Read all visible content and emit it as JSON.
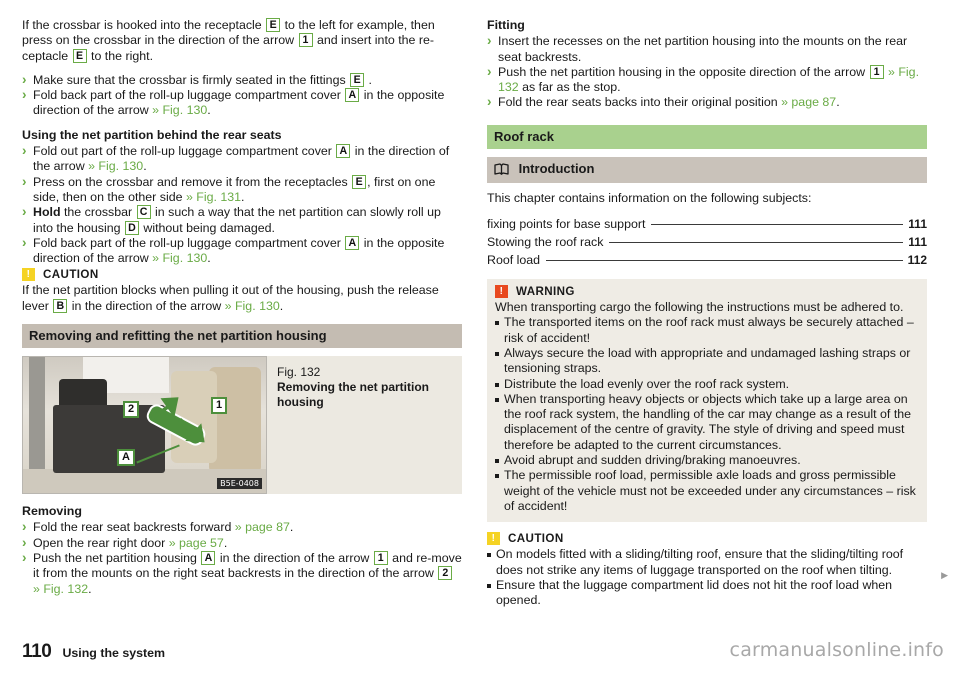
{
  "left_column": {
    "intro_paragraph_segments": [
      {
        "t": "If the crossbar is hooked into the receptacle "
      },
      {
        "t": "E",
        "ref": true
      },
      {
        "t": " to the left for example, then press on the crossbar in the direction of the arrow "
      },
      {
        "t": "1",
        "ref": true
      },
      {
        "t": " and insert into the receptacle "
      },
      {
        "t": "E",
        "ref": true
      },
      {
        "t": " to the right."
      }
    ],
    "intro_bullets": [
      "Make sure that the crossbar is firmly seated in the fittings E .",
      "Fold back part of the roll-up luggage compartment cover A in the opposite direction of the arrow » Fig. 130."
    ],
    "heading_using_net_partition": "Using the net partition behind the rear seats",
    "using_bullets": [
      "Fold out part of the roll-up luggage compartment cover A in the direction of the arrow » Fig. 130.",
      "Press on the crossbar and remove it from the receptacles E , first on one side, then on the other side » Fig. 131.",
      "Hold the crossbar C in such a way that the net partition can slowly roll up into the housing D without being damaged.",
      "Fold back part of the roll-up luggage compartment cover A in the opposite direction of the arrow » Fig. 130."
    ],
    "caution": {
      "title": "CAUTION",
      "icon": "exclamation-icon",
      "body": "If the net partition blocks when pulling it out of the housing, push the release lever B in the direction of the arrow » Fig. 130."
    },
    "section_header": "Removing and refitting the net partition housing",
    "figure": {
      "number": "Fig. 132",
      "title_line1": "Removing the net partition",
      "title_line2": "housing",
      "image_code": "B5E-0408",
      "callouts": [
        "2",
        "1",
        "A"
      ]
    },
    "heading_removing": "Removing",
    "removing_bullets": [
      "Fold the rear seat backrests forward » page 87.",
      "Open the rear right door » page 57.",
      "Push the net partition housing A in the direction of the arrow 1 and remove it from the mounts on the right seat backrests in the direction of the arrow 2 » Fig. 132."
    ]
  },
  "right_column": {
    "heading_fitting": "Fitting",
    "fitting_bullets": [
      "Insert the recesses on the net partition housing into the mounts on the rear seat backrests.",
      "Push the net partition housing in the opposite direction of the arrow 1 » Fig. 132 as far as the stop.",
      "Fold the rear seats backs into their original position » page 87."
    ],
    "chapter_header": "Roof rack",
    "introduction_header": "Introduction",
    "introduction_icon": "open-book-icon",
    "intro_lead": "This chapter contains information on the following subjects:",
    "toc": [
      {
        "label": "fixing points for base support",
        "page": "111"
      },
      {
        "label": "Stowing the roof rack",
        "page": "111"
      },
      {
        "label": "Roof load",
        "page": "112"
      }
    ],
    "warning": {
      "title": "WARNING",
      "icon": "exclamation-icon",
      "lead": "When transporting cargo the following the instructions must be adhered to.",
      "items": [
        "The transported items on the roof rack must always be securely attached – risk of accident!",
        "Always secure the load with appropriate and undamaged lashing straps or tensioning straps.",
        "Distribute the load evenly over the roof rack system.",
        "When transporting heavy objects or objects which take up a large area on the roof rack system, the handling of the car may change as a result of the displacement of the centre of gravity. The style of driving and speed must therefore be adapted to the current circumstances.",
        "Avoid abrupt and sudden driving/braking manoeuvres.",
        "The permissible roof load, permissible axle loads and gross permissible weight of the vehicle must not be exceeded under any circumstances – risk of accident!"
      ]
    },
    "caution": {
      "title": "CAUTION",
      "icon": "exclamation-icon",
      "items": [
        "On models fitted with a sliding/tilting roof, ensure that the sliding/tilting roof does not strike any items of luggage transported on the roof when tilting.",
        "Ensure that the luggage compartment lid does not hit the roof load when opened."
      ]
    },
    "continuation_marker": "▶"
  },
  "footer": {
    "page_number": "110",
    "section_name": "Using the system",
    "watermark": "carmanualsonline.info"
  },
  "colors": {
    "accent_green": "#6aab46",
    "chapter_bar": "#a9d18e",
    "section_bar": "#c4bcb2",
    "subsection_bar": "#c9c2ba",
    "warning_icon": "#e8491f",
    "caution_icon": "#f5d324",
    "notice_bg": "#efece5"
  }
}
